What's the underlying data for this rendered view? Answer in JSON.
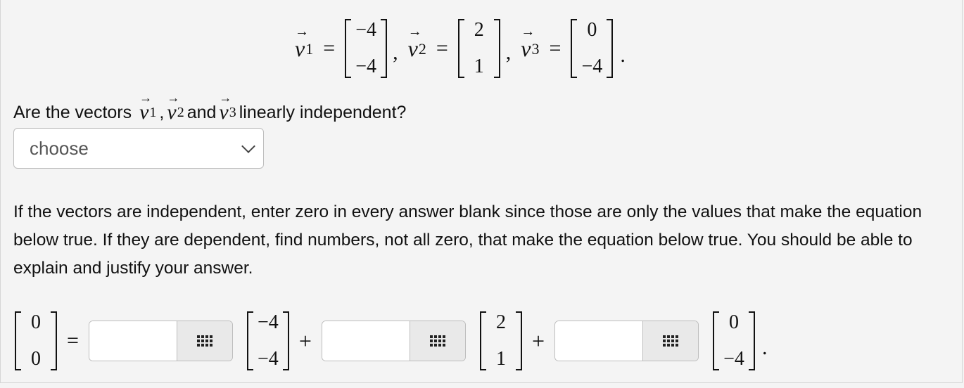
{
  "definitions": {
    "v1": {
      "name": "v",
      "sub": "1",
      "entries": [
        "−4",
        "−4"
      ]
    },
    "v2": {
      "name": "v",
      "sub": "2",
      "entries": [
        "2",
        "1"
      ]
    },
    "v3": {
      "name": "v",
      "sub": "3",
      "entries": [
        "0",
        "−4"
      ]
    },
    "equals": "=",
    "comma": ",",
    "period": "."
  },
  "question": {
    "prefix": "Are the vectors",
    "comma": ",",
    "and": "and",
    "suffix": "linearly independent?"
  },
  "select": {
    "value": "choose"
  },
  "instructions": "If the vectors are independent, enter zero in every answer blank since those are only the values that make the equation below true. If they are dependent, find numbers, not all zero, that make the equation below true. You should be able to explain and justify your answer.",
  "equation": {
    "lhs": [
      "0",
      "0"
    ],
    "equals": "=",
    "plus": "+",
    "period": ".",
    "terms": [
      {
        "value": "",
        "vector": [
          "−4",
          "−4"
        ]
      },
      {
        "value": "",
        "vector": [
          "2",
          "1"
        ]
      },
      {
        "value": "",
        "vector": [
          "0",
          "−4"
        ]
      }
    ]
  },
  "icons": {
    "arrow": "→",
    "grid": "grid-icon"
  }
}
